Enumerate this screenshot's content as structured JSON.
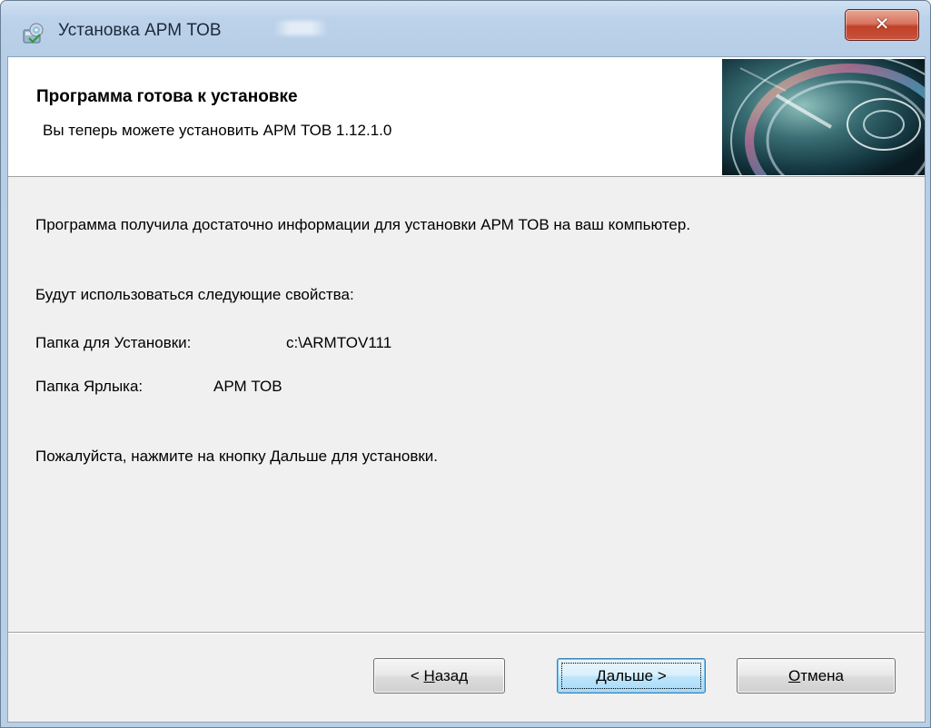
{
  "window": {
    "title": "Установка АРМ ТОВ"
  },
  "header": {
    "title": "Программа готова к установке",
    "subtitle": "Вы теперь можете установить АРМ ТОВ 1.12.1.0"
  },
  "body": {
    "intro": "Программа получила достаточно информации для установки АРМ ТОВ на ваш компьютер.",
    "props_heading": "Будут использоваться следующие свойства:",
    "install_folder_label": "Папка для Установки:",
    "install_folder_value": "c:\\ARMTOV111",
    "shortcut_folder_label": "Папка Ярлыка:",
    "shortcut_folder_value": "АРМ ТОВ",
    "instruction": "Пожалуйста, нажмите на кнопку Дальше для установки."
  },
  "buttons": {
    "back_prefix": "< ",
    "back_mnemonic": "Н",
    "back_rest": "азад",
    "next_mnemonic": "Д",
    "next_rest": "альше >",
    "cancel_mnemonic": "О",
    "cancel_rest": "тмена"
  },
  "icons": {
    "app": "installer-disc-icon",
    "close": "close-icon",
    "banner": "cd-disc-banner"
  },
  "colors": {
    "close_button": "#c8533c",
    "default_button_border": "#3c7fb1"
  }
}
